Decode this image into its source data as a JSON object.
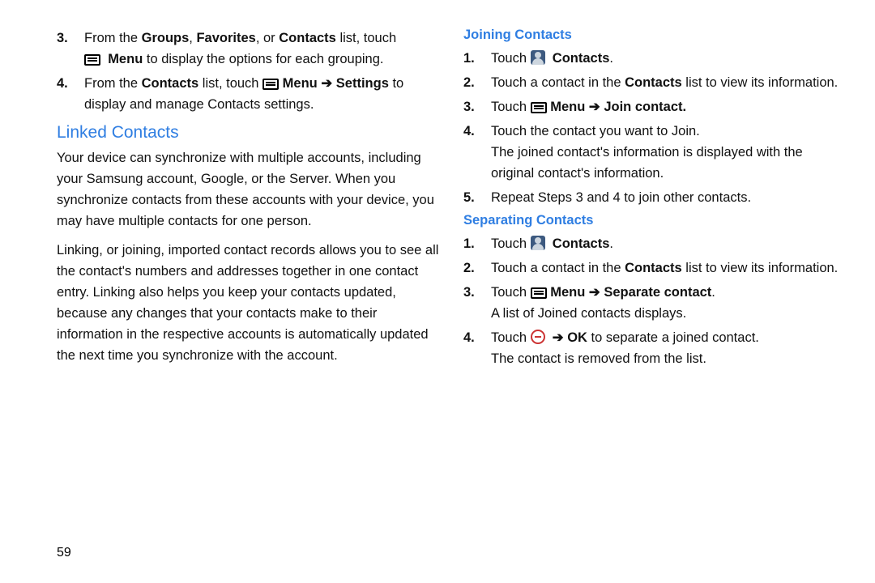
{
  "page_number": "59",
  "arrow": "➔",
  "left": {
    "step3": {
      "pre": "From the ",
      "g": "Groups",
      "sep1": ", ",
      "f": "Favorites",
      "sep2": ", or ",
      "c": "Contacts",
      "post": " list, touch",
      "line2a": "Menu",
      "line2b": " to display the options for each grouping."
    },
    "step4": {
      "pre": "From the ",
      "c": "Contacts",
      "mid": " list, touch ",
      "menu": "Menu",
      "settings": "Settings",
      "post": " to",
      "line2": "display and manage Contacts settings."
    },
    "linked_heading": "Linked Contacts",
    "para1": "Your device can synchronize with multiple accounts, including your Samsung account, Google, or the Server. When you synchronize contacts from these accounts with your device, you may have multiple contacts for one person.",
    "para2": "Linking, or joining, imported contact records allows you to see all the contact's numbers and addresses together in one contact entry. Linking also helps you keep your contacts updated, because any changes that your contacts make to their information in the respective accounts is automatically updated the next time you synchronize with the account."
  },
  "joining": {
    "heading": "Joining Contacts",
    "s1": {
      "touch": "Touch ",
      "contacts": "Contacts",
      "dot": "."
    },
    "s2": {
      "pre": "Touch a contact in the ",
      "c": "Contacts",
      "post": " list to view its information."
    },
    "s3": {
      "touch": "Touch ",
      "menu": "Menu",
      "join": "Join contact",
      "dot": "."
    },
    "s4": {
      "line1": "Touch the contact you want to Join.",
      "line2": "The joined contact's information is displayed with the original contact's information."
    },
    "s5": "Repeat Steps 3 and 4 to join other contacts."
  },
  "separating": {
    "heading": "Separating Contacts",
    "s1": {
      "touch": "Touch ",
      "contacts": "Contacts",
      "dot": "."
    },
    "s2": {
      "pre": "Touch a contact in the ",
      "c": "Contacts",
      "post": " list to view its information."
    },
    "s3": {
      "touch": "Touch ",
      "menu": "Menu",
      "sep": "Separate contact",
      "dot": ".",
      "line2": "A list of Joined contacts displays."
    },
    "s4": {
      "touch": "Touch ",
      "ok": "OK",
      "post": " to separate a joined contact.",
      "line2": "The contact is removed from the list."
    }
  }
}
